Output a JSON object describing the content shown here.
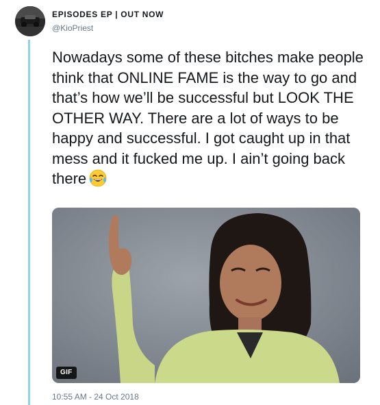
{
  "author": {
    "display_name": "EPISODES EP | OUT NOW",
    "handle": "@KioPriest"
  },
  "tweet": {
    "text": "Nowadays some of these bitches make people think that ONLINE FAME is the way to go and that’s how we’ll be successful but LOOK THE OTHER WAY. There are a lot of ways to be happy and successful. I got caught up in that mess and it fucked me up. I ain’t going back there",
    "emoji": "face-with-tears-of-joy-emoji"
  },
  "media": {
    "badge": "GIF"
  },
  "timestamp": "10:55 AM - 24 Oct 2018",
  "colors": {
    "thread_line": "#8fd3ea",
    "text": "#14171a",
    "secondary_text": "#657786"
  }
}
